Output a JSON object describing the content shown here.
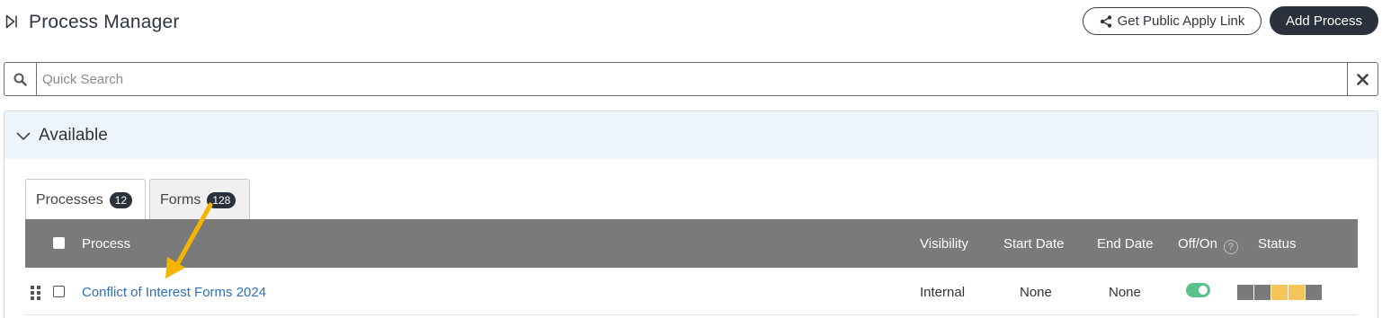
{
  "header": {
    "title": "Process Manager",
    "public_link_label": "Get Public Apply Link",
    "add_process_label": "Add Process"
  },
  "search": {
    "placeholder": "Quick Search",
    "value": ""
  },
  "panel": {
    "title": "Available",
    "tabs": [
      {
        "label": "Processes",
        "count": "12",
        "active": true
      },
      {
        "label": "Forms",
        "count": "128",
        "active": false
      }
    ]
  },
  "table": {
    "columns": {
      "process": "Process",
      "visibility": "Visibility",
      "start_date": "Start Date",
      "end_date": "End Date",
      "offon": "Off/On",
      "help": "?",
      "status": "Status"
    },
    "rows": [
      {
        "process": "Conflict of Interest Forms 2024",
        "visibility": "Internal",
        "start_date": "None",
        "end_date": "None",
        "enabled": true,
        "status_segments": [
          "#7a7a7a",
          "#7a7a7a",
          "#f6c55a",
          "#f6c55a",
          "#7a7a7a"
        ]
      }
    ]
  },
  "colors": {
    "accent_dark": "#2a313c",
    "link": "#2f6fb3",
    "toggle_on": "#5ac08c",
    "annotation_arrow": "#f4b400"
  }
}
